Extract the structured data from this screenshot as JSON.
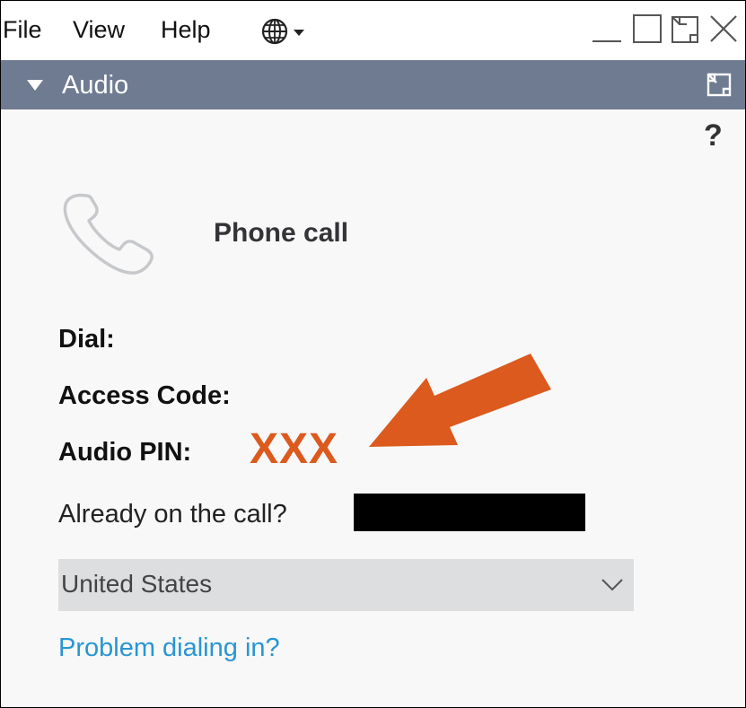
{
  "menu": {
    "file": "File",
    "view": "View",
    "help": "Help",
    "language_icon": "globe-icon"
  },
  "window_controls": {
    "minimize_icon": "minimize-icon",
    "maximize_icon": "maximize-icon",
    "restore_icon": "restore-icon",
    "close_icon": "close-icon"
  },
  "section": {
    "title": "Audio",
    "collapse_icon": "triangle-down-icon",
    "popout_icon": "popout-icon",
    "header_color": "#6f7b91"
  },
  "help": {
    "label": "?"
  },
  "phone": {
    "icon": "phone-icon",
    "label": "Phone call"
  },
  "fields": {
    "dial_label": "Dial:",
    "access_code_label": "Access Code:",
    "audio_pin_label": "Audio PIN:",
    "audio_pin_value": "XXX",
    "audio_pin_color": "#dc5a1e"
  },
  "already": {
    "label": "Already on the call?"
  },
  "country": {
    "selected": "United States"
  },
  "links": {
    "problem": "Problem dialing in?",
    "link_color": "#2796d4"
  },
  "annotation": {
    "arrow_color": "#dc5a1e"
  }
}
